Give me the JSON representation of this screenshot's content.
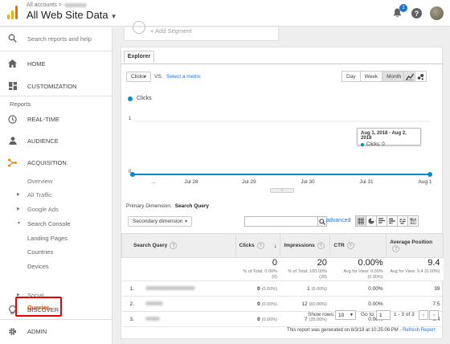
{
  "header": {
    "account_label": "All accounts",
    "property_title": "All Web Site Data",
    "notification_count": "1",
    "help_glyph": "?"
  },
  "sidebar": {
    "search_placeholder": "Search reports and help",
    "home": "HOME",
    "customization": "CUSTOMIZATION",
    "reports_section": "Reports",
    "realtime": "REAL-TIME",
    "audience": "AUDIENCE",
    "acquisition": "ACQUISITION",
    "overview": "Overview",
    "all_traffic": "All Traffic",
    "google_ads": "Google Ads",
    "search_console": "Search Console",
    "landing_pages": "Landing Pages",
    "countries": "Countries",
    "devices": "Devices",
    "queries": "Queries",
    "social": "Social",
    "discover": "DISCOVER",
    "admin": "ADMIN"
  },
  "segment": {
    "add_label": "+ Add Segment"
  },
  "explorer": {
    "tab": "Explorer",
    "metric_dropdown": "Clicks",
    "vs": "VS.",
    "select_metric": "Select a metric",
    "period_buttons": [
      "Day",
      "Week",
      "Month"
    ],
    "active_period": "Month"
  },
  "chart_data": {
    "type": "line",
    "series": [
      {
        "name": "Clicks",
        "values": [
          0,
          0,
          0,
          0,
          0,
          0
        ]
      }
    ],
    "x_ticks": [
      "...",
      "Jul 28",
      "Jul 29",
      "Jul 30",
      "Jul 31",
      "Aug 1"
    ],
    "ylim": [
      0,
      1
    ],
    "y_ticks": [
      "1",
      "0"
    ],
    "color": "#058dc7",
    "tooltip": {
      "range": "Aug 1, 2018 - Aug 2, 2018",
      "value": "Clicks: 0"
    }
  },
  "table": {
    "primary_dimension_label": "Primary Dimension:",
    "primary_dimension_value": "Search Query",
    "secondary_dimension": "Secondary dimension",
    "advanced": "advanced",
    "columns": [
      "Search Query",
      "Clicks",
      "Impressions",
      "CTR",
      "Average Position"
    ],
    "totals": {
      "clicks": "0",
      "clicks_sub": "% of Total: 0.00% (0)",
      "impressions": "20",
      "impressions_sub": "% of Total: 100.00% (20)",
      "ctr": "0.00%",
      "ctr_sub": "Avg for View: 0.00% (0.00%)",
      "position": "9.4",
      "position_sub": "Avg for View: 9.4 (0.00%)"
    },
    "rows": [
      {
        "num": "1.",
        "clicks": "0",
        "clicks_pct": "(0.00%)",
        "impr": "1",
        "impr_pct": "(5.00%)",
        "ctr": "0.00%",
        "pos": "39"
      },
      {
        "num": "2.",
        "clicks": "0",
        "clicks_pct": "(0.00%)",
        "impr": "12",
        "impr_pct": "(60.00%)",
        "ctr": "0.00%",
        "pos": "7.5"
      },
      {
        "num": "3.",
        "clicks": "0",
        "clicks_pct": "(0.00%)",
        "impr": "7",
        "impr_pct": "(35.00%)",
        "ctr": "0.00%",
        "pos": "8.4"
      }
    ],
    "show_rows_label": "Show rows:",
    "show_rows_value": "10",
    "goto_label": "Go to:",
    "goto_value": "1",
    "page_range": "1 - 3 of 3",
    "generated_text": "This report was generated on 8/3/18 at 10:25:06 PM -",
    "refresh": "Refresh Report"
  }
}
